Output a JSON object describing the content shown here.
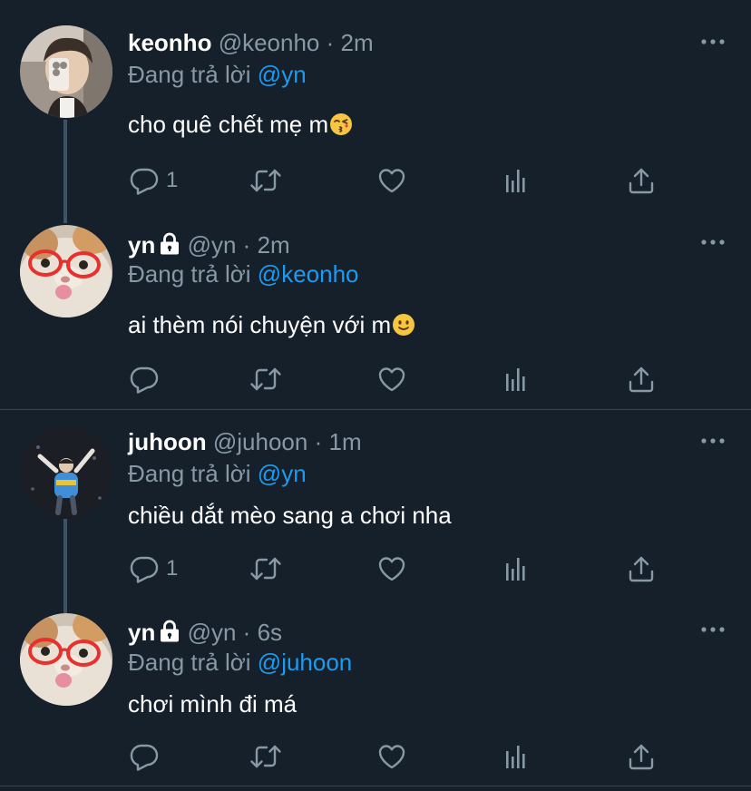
{
  "reply_prefix": "Đang trả lời",
  "tweets": [
    {
      "name": "keonho",
      "handle": "@keonho",
      "separator": "·",
      "time": "2m",
      "reply_to": "@yn",
      "text": "cho quê chết mẹ m",
      "emoji": "kissing-face-emoji",
      "reply_count": "1",
      "locked": false
    },
    {
      "name": "yn",
      "handle": "@yn",
      "separator": "·",
      "time": "2m",
      "reply_to": "@keonho",
      "text": "ai thèm nói chuyện với m",
      "emoji": "slightly-smiling-face-emoji",
      "reply_count": "",
      "locked": true
    },
    {
      "name": "juhoon",
      "handle": "@juhoon",
      "separator": "·",
      "time": "1m",
      "reply_to": "@yn",
      "text": "chiều dắt mèo sang a chơi nha",
      "emoji": "",
      "reply_count": "1",
      "locked": false
    },
    {
      "name": "yn",
      "handle": "@yn",
      "separator": "·",
      "time": "6s",
      "reply_to": "@juhoon",
      "text": "chơi mình đi má",
      "emoji": "",
      "reply_count": "",
      "locked": true
    }
  ],
  "colors": {
    "background": "#15202b",
    "text": "#ffffff",
    "secondary": "#8899a6",
    "link": "#1d9bf0",
    "thread_line": "#3d5466",
    "divider": "#38444d"
  },
  "icons": [
    "reply-icon",
    "retweet-icon",
    "like-icon",
    "analytics-icon",
    "share-icon",
    "more-icon",
    "lock-icon"
  ]
}
